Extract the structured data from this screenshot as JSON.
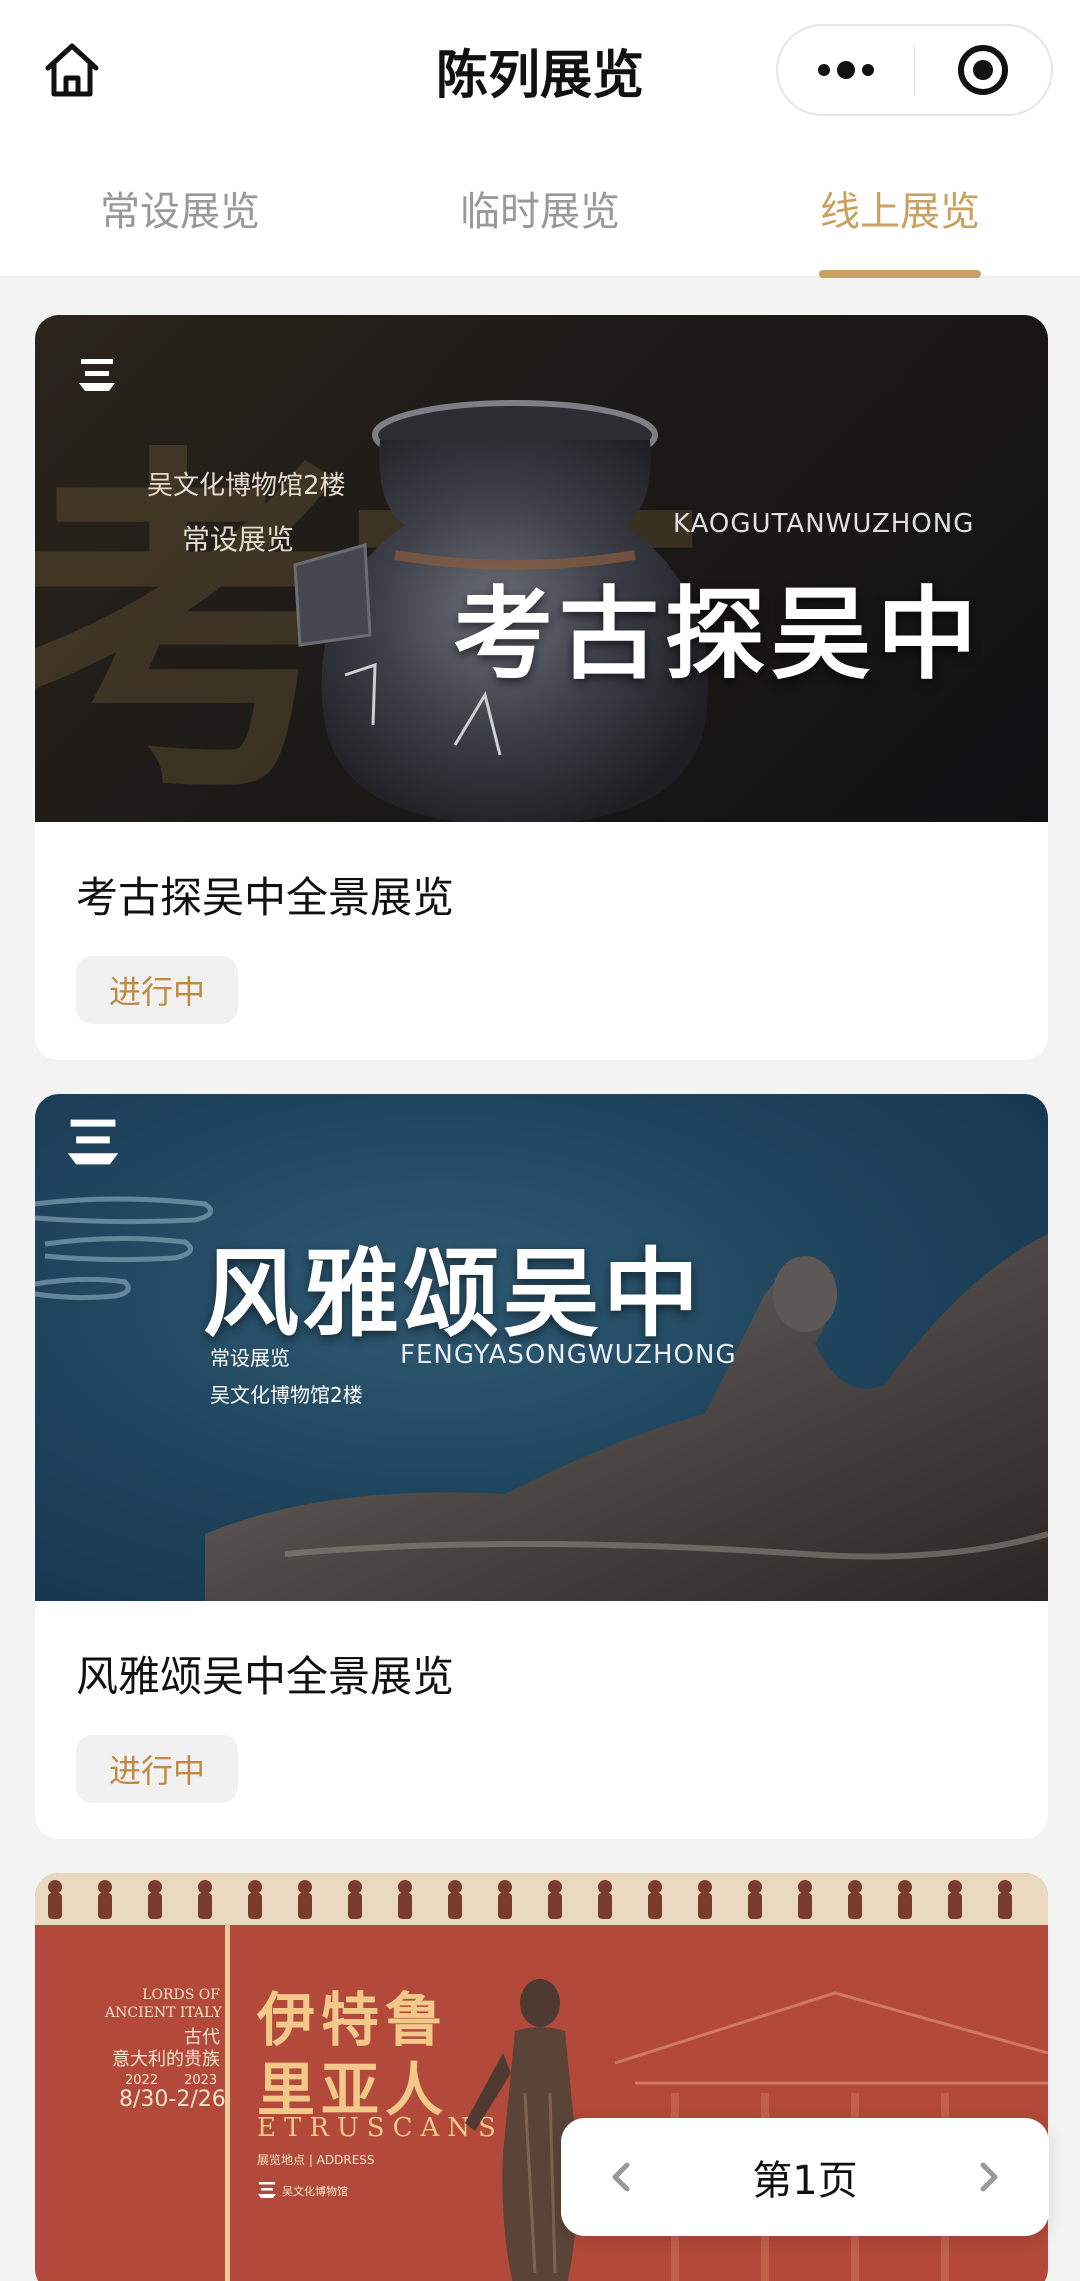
{
  "header": {
    "title": "陈列展览",
    "home_icon": "home-icon",
    "more_icon": "more-dots-icon",
    "close_icon": "miniapp-close-icon"
  },
  "tabs": [
    {
      "label": "常设展览",
      "active": false
    },
    {
      "label": "临时展览",
      "active": false
    },
    {
      "label": "线上展览",
      "active": true
    }
  ],
  "colors": {
    "accent": "#c9a161",
    "badge_text": "#c08a3e",
    "badge_bg": "#f1f1f1",
    "page_bg": "#f3f3f3"
  },
  "cards": [
    {
      "title": "考古探吴中全景展览",
      "status": "进行中",
      "banner": {
        "floor": "吴文化博物馆2楼",
        "category": "常设展览",
        "pinyin": "KAOGUTANWUZHONG",
        "headline": "考古探吴中"
      }
    },
    {
      "title": "风雅颂吴中全景展览",
      "status": "进行中",
      "banner": {
        "headline": "风雅颂吴中",
        "category": "常设展览",
        "floor": "吴文化博物馆2楼",
        "pinyin": "FENGYASONGWUZHONG"
      }
    },
    {
      "banner": {
        "en_title_1": "LORDS OF",
        "en_title_2": "ANCIENT ITALY",
        "cn_sub_1": "古代",
        "cn_sub_2": "意大利的贵族",
        "years": "2022　　2023",
        "dates": "8/30-2/26",
        "headline_1": "伊特鲁",
        "headline_2": "里亚人",
        "en_headline": "ETRUSCANS",
        "venue": "展览地点 | ADDRESS",
        "museum": "吴文化博物馆"
      }
    }
  ],
  "pager": {
    "label": "第1页"
  }
}
